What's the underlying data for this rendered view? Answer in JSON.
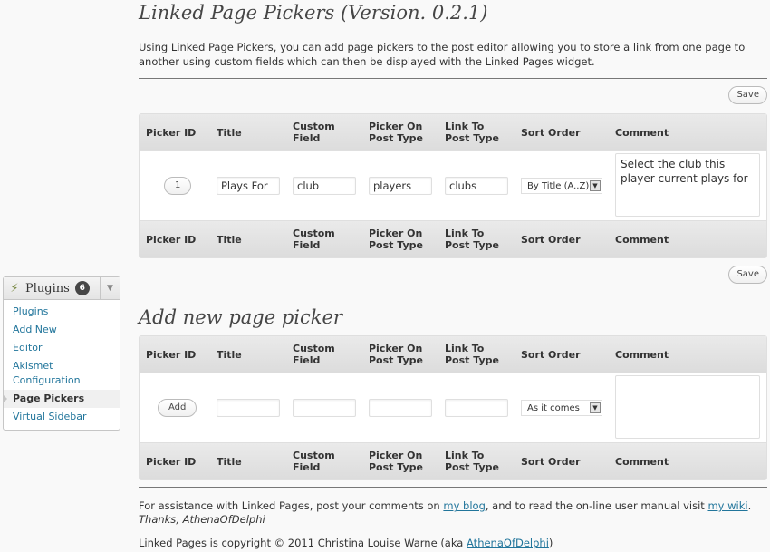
{
  "sidebar": {
    "menu_title": "Plugins",
    "update_count": "6",
    "items": [
      {
        "label": "Plugins"
      },
      {
        "label": "Add New"
      },
      {
        "label": "Editor"
      },
      {
        "label": "Akismet Configuration"
      },
      {
        "label": "Page Pickers"
      },
      {
        "label": "Virtual Sidebar"
      }
    ]
  },
  "page": {
    "title": "Linked Page Pickers (Version. 0.2.1)",
    "intro": "Using Linked Page Pickers, you can add page pickers to the post editor allowing you to store a link from one page to another using custom fields which can then be displayed with the Linked Pages widget."
  },
  "buttons": {
    "save": "Save",
    "add": "Add"
  },
  "columns": [
    "Picker ID",
    "Title",
    "Custom Field",
    "Picker On Post Type",
    "Link To Post Type",
    "Sort Order",
    "Comment"
  ],
  "pickers": [
    {
      "id": "1",
      "title": "Plays For",
      "custom_field": "club",
      "picker_on": "players",
      "link_to": "clubs",
      "sort_order": "By Title (A..Z)",
      "comment": "Select the club this player current plays for"
    }
  ],
  "new_picker": {
    "heading": "Add new page picker",
    "title": "",
    "custom_field": "",
    "picker_on": "",
    "link_to": "",
    "sort_order": "As it comes",
    "comment": ""
  },
  "footer": {
    "assist_prefix": "For assistance with Linked Pages, post your comments on ",
    "blog_link": "my blog",
    "assist_middle": ", and to read the on-line user manual visit ",
    "wiki_link": "my wiki",
    "assist_suffix": ".",
    "thanks": "Thanks, AthenaOfDelphi",
    "copyright_prefix": "Linked Pages is copyright © 2011 Christina Louise Warne (aka ",
    "copyright_link": "AthenaOfDelphi",
    "copyright_suffix": ")"
  }
}
